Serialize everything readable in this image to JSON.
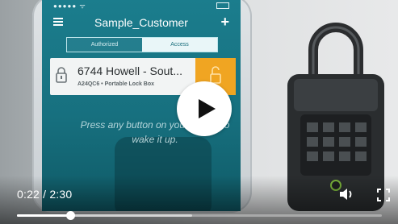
{
  "video": {
    "frame": {
      "status_dots": "●●●●● ᯤ",
      "app_title": "Sample_Customer",
      "tabs": [
        {
          "label": "Authorized",
          "active": false
        },
        {
          "label": "Access",
          "active": true
        }
      ],
      "lock": {
        "name": "6744 Howell - Sout...",
        "subtitle": "A24QC6 • Portable Lock Box"
      },
      "wake_message": "Press any button on your device to wake it up."
    },
    "controls": {
      "time_display": "0:22 / 2:30",
      "progress_fraction": 0.147,
      "buffered_fraction": 0.48
    },
    "colors": {
      "screen_teal": "#1b7d8d",
      "unlock_orange": "#f0a522"
    },
    "icons": {
      "play": "play-icon",
      "volume": "volume-icon",
      "fullscreen": "fullscreen-icon",
      "menu": "hamburger-menu-icon",
      "add": "plus-icon",
      "lock": "padlock-icon"
    }
  }
}
